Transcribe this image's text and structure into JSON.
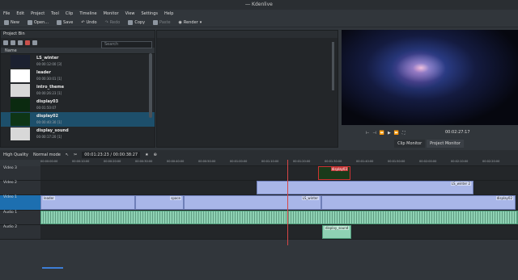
{
  "window": {
    "title": "― Kdenlive"
  },
  "menu": [
    "File",
    "Edit",
    "Project",
    "Tool",
    "Clip",
    "Timeline",
    "Monitor",
    "View",
    "Settings",
    "Help"
  ],
  "toolbar": {
    "new": "New",
    "open": "Open...",
    "save": "Save",
    "undo": "Undo",
    "redo": "Redo",
    "copy": "Copy",
    "paste": "Paste",
    "render": "Render"
  },
  "bin": {
    "title": "Project Bin",
    "search_placeholder": "Search",
    "column": "Name",
    "clips": [
      {
        "name": "LS_winter",
        "duration": "00:00:12:00 [3]"
      },
      {
        "name": "leader",
        "duration": "00:00:30:01 [1]"
      },
      {
        "name": "intro_theme",
        "duration": "00:00:26:23 [1]"
      },
      {
        "name": "display03",
        "duration": "00:01:50:07"
      },
      {
        "name": "display02",
        "duration": "00:00:40:30 [1]"
      },
      {
        "name": "display_sound",
        "duration": "00:00:17:20 [1]"
      }
    ]
  },
  "monitor": {
    "timecode": "00:02:27:17",
    "tabs": [
      "Clip Monitor",
      "Project Monitor"
    ],
    "active_tab": "Project Monitor"
  },
  "timeline": {
    "quality": "High Quality",
    "mode": "Normal mode",
    "timecode": "00:01:23:23 / 00:00:38:27",
    "ruler": [
      "00:00:00:00",
      "00:00:10:00",
      "00:00:20:00",
      "00:00:30:00",
      "00:00:40:00",
      "00:00:50:00",
      "00:01:00:00",
      "00:01:10:00",
      "00:01:20:00",
      "00:01:30:00",
      "00:01:40:00",
      "00:01:50:00",
      "00:02:00:00",
      "00:02:10:00",
      "00:02:20:00"
    ],
    "tracks": [
      {
        "name": "Video 3",
        "clips": [
          {
            "label": "display03"
          }
        ]
      },
      {
        "name": "Video 2",
        "clips": [
          {
            "label": "LS_winter 2"
          }
        ]
      },
      {
        "name": "Video 1",
        "clips": [
          {
            "label": "leader"
          },
          {
            "label": "space"
          },
          {
            "label": "LS_winter"
          },
          {
            "label": "display02"
          }
        ]
      },
      {
        "name": "Audio 1",
        "clips": []
      },
      {
        "name": "Audio 2",
        "clips": [
          {
            "label": "display_sound"
          }
        ]
      }
    ]
  }
}
